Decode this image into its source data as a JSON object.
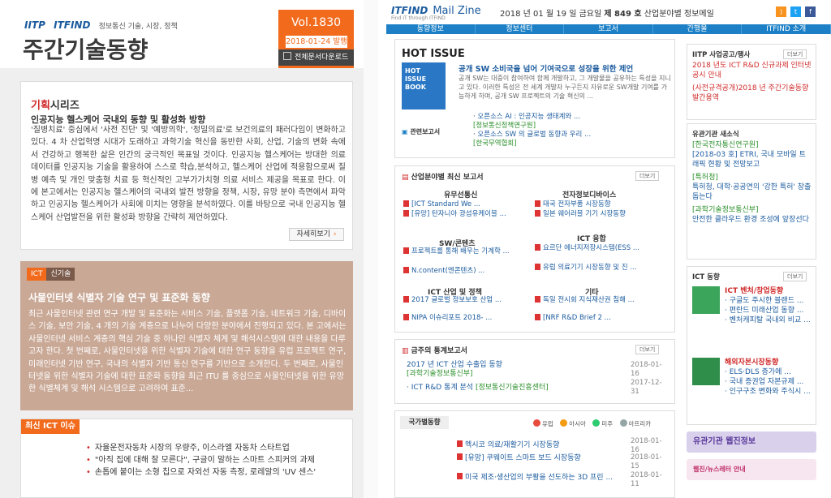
{
  "left": {
    "brand_itp": "IITP",
    "brand_itfind": "ITFIND",
    "brand_sub": "정보통신 기술, 시장, 정책",
    "logo_title": "주간기술동향",
    "vol": "Vol.1830",
    "issue_date": "2018-01-24 발행",
    "download_label": "전체문서다운로드",
    "feature": {
      "series_prefix": "기획",
      "series_rest": "시리즈",
      "title": "인공지능 헬스케어 국내외 동향 및 활성화 방향",
      "body": "'질병치료' 중심에서 '사전 진단' 및 '예방의학', '정밀의료'로 보건의료의 패러다임이 변화하고 있다. 4 차 산업혁명 시대가 도래하고 과학기술 혁신을 동반한 사회, 산업, 기술의 변화 속에서 건강하고 행복한 삶은 인간의 궁극적인 목표일 것이다. 인공지능 헬스케어는 방대한 의료 데이터를 인공지능 기술을 활용하여 스스로 학습,분석하고, 헬스케어 산업에 적용함으로써 질병 예측 및 개인 맞춤형 치료 등 혁신적인 고부가가치형 의료 서비스 제공을 목표로 한다. 이에 본고에서는 인공지능 헬스케어의 국내외 발전 방향을 정책, 시장, 유망 분야 측면에서 파악하고 인공지능 헬스케어가 사회에 미치는 영향을 분석하였다. 이를 바탕으로 국내 인공지능 헬스케어 산업발전을 위한 활성화 방향을 간략히 제언하였다.",
      "more": "자세히보기"
    },
    "ict": {
      "tag1": "ICT",
      "tag2": "신기술",
      "title": "사물인터넷 식별자 기술 연구 및 표준화 동향",
      "body": "최근 사물인터넷 관련 연구 개발 및 표준화는 서비스 기술, 플랫폼 기술, 네트워크 기술, 디바이스 기술, 보안 기술, 4 개의 기술 계층으로 나누어 다양한 분야에서 진행되고 있다. 본 고에서는 사물인터넷 서비스 계층의 핵심 기술 중 하나인 식별자 체계 및 해석시스템에 대한 내용을 다루고자 한다. 첫 번째로, 사물인터넷을 위한 식별자 기술에 대한 연구 동향을 유럽 프로젝트 연구, 미래인터넷 기반 연구, 국내의 식별자 기반 통신 연구를 기반으로 소개한다. 두 번째로, 사물인터넷을 위한 식별자 기술에 대한 표준화 동향을 최근 ITU 를 중심으로 사물인터넷을 위한 유망한 식별체계 및 해석 시스템으로 고려하여 표준..."
    },
    "news": {
      "tag": "최신 ICT 이슈",
      "items": [
        "자율운전자동차 시장의 우량주, 이스라엘 자동차 스타트업",
        "\"아직 집에 대해 잘 모른다\", 구글이 말하는 스마트 스피커의 과제",
        "손톱에 붙이는 소형 칩으로 자외선 자동 측정, 로레알의 'UV 센스'"
      ]
    }
  },
  "right": {
    "logo_itfind": "ITFIND",
    "logo_mailzine": "Mail Zine",
    "logo_tag": "Find IT through ITFIND",
    "date_line_pre": "2018 년 01 월 19 일 금요일 ",
    "date_line_bold": "제 849 호",
    "date_line_post": " 산업분야별 정보메일",
    "nav": [
      "동향정보",
      "정보센터",
      "보고서",
      "간행물",
      "ITFIND 소개"
    ],
    "hot": {
      "title": "HOT ISSUE",
      "book": "HOT ISSUE BOOK",
      "headline": "공개 SW 소비국을 넘어 기여국으로 성장을 위한 제언",
      "desc": "공개 SW는 대중이 참여하여 함께 개발하고, 그 개발물을 공유하는 특성을 지니고 있다. 이러한 특성은 전 세계 개발자 누구든지 자유로운 SW개발 기여를 가능하게 하며, 공개 SW 프로젝트의 기술 혁신의 ...",
      "related_label": "관련보고서",
      "related": [
        {
          "title": "오픈소스 AI : 인공지능 생태계와 ...",
          "source": "[정보통신정책연구원]"
        },
        {
          "title": "오픈소스 SW 의 글로벌 동향과 우리 ...",
          "source": "[한국무역협회]"
        }
      ]
    },
    "sections": {
      "title": "산업분야별 최신 보고서",
      "more": "더보기",
      "cats": [
        "유무선통신",
        "전자정보디바이스",
        "SW/콘텐츠",
        "ICT 융합",
        "ICT 산업 및 정책",
        "기타"
      ],
      "items": [
        "[ICT Standard We ...",
        "[유망] 탄자니아 광섬유케이블 ...",
        "태국 전자부품 시장동향",
        "일본 웨어러블 기기 시장동향",
        "프로젝트를 통해 배우는 기계학 ...",
        "N.content(엔콘텐츠) ...",
        "요르단 에너지저장시스템(ESS ...",
        "유럽 의료기기 시장동향 및 진 ...",
        "2017 글로벌 정보보호 산업 ...",
        "NIPA 이슈리포트 2018- ...",
        "독일 전시회 지식재산권 침해 ...",
        "[NRF R&D Brief 2 ..."
      ]
    },
    "stats": {
      "title": "금주의 통계보고서",
      "more": "더보기",
      "rows": [
        {
          "title": "2017 년 ICT 산업 수출입 동향",
          "source": "[과학기술정보통신부]",
          "date": "2018-01-16"
        },
        {
          "title": "ICT R&D 통계 분석",
          "source": "[정보통신기술진흥센터]",
          "date": "2017-12-31"
        }
      ]
    },
    "nations": {
      "tab": "국가별동향",
      "legend": [
        "유럽",
        "아시아",
        "미주",
        "아프리카"
      ],
      "legend_colors": [
        "#e84c3d",
        "#f39c12",
        "#2ecc71",
        "#95a5a6"
      ],
      "rows": [
        {
          "title": "멕시코 의료/재활기기 시장동향",
          "date": "2018-01-16"
        },
        {
          "title": "[유망] 쿠웨이트 스마트 보드 시장동향",
          "date": "2018-01-15"
        },
        {
          "title": "미국 제조·생산업의 부활을 선도하는 3D 프린 ...",
          "date": "2018-01-11"
        }
      ]
    },
    "side": {
      "notice_title": "IITP 사업공고/행사",
      "notice_items": [
        "2018 년도 ICT R&D 신규과제 인터넷 공시 안내",
        "(사전규격공개)2018 년 주간기술동향 발간용역"
      ],
      "news_title": "유관기관 새소식",
      "news_items": [
        {
          "source": "[한국전자통신연구원]",
          "title": "[2018-03 호] ETRI, 국내 모바일 트래픽 현황 및 전망보고"
        },
        {
          "source": "[특허청]",
          "title": "특허청, 대학·공공연의 '강한 특허' 창출 돕는다"
        },
        {
          "source": "[과학기술정보통신부]",
          "title": "안전한 클라우드 환경 조성에 앞장선다"
        }
      ],
      "ict_title": "ICT 동향",
      "ict_head1": "ICT 벤처/창업동향",
      "ict_items1": [
        "구글도 주시한 블랜드 ...",
        "편란드 미래산업 동향 ...",
        "벤처캐피탈 국내외 비교 ..."
      ],
      "ict_head2": "해외자본시장동향",
      "ict_items2": [
        "ELS·DLS 증가에 ...",
        "국내 증권업 자본규제 ...",
        "인구구조 변화와 주식시 ..."
      ],
      "banner1": "유관기관 웹진정보",
      "banner2": "웹진/뉴스레터 안내"
    }
  }
}
